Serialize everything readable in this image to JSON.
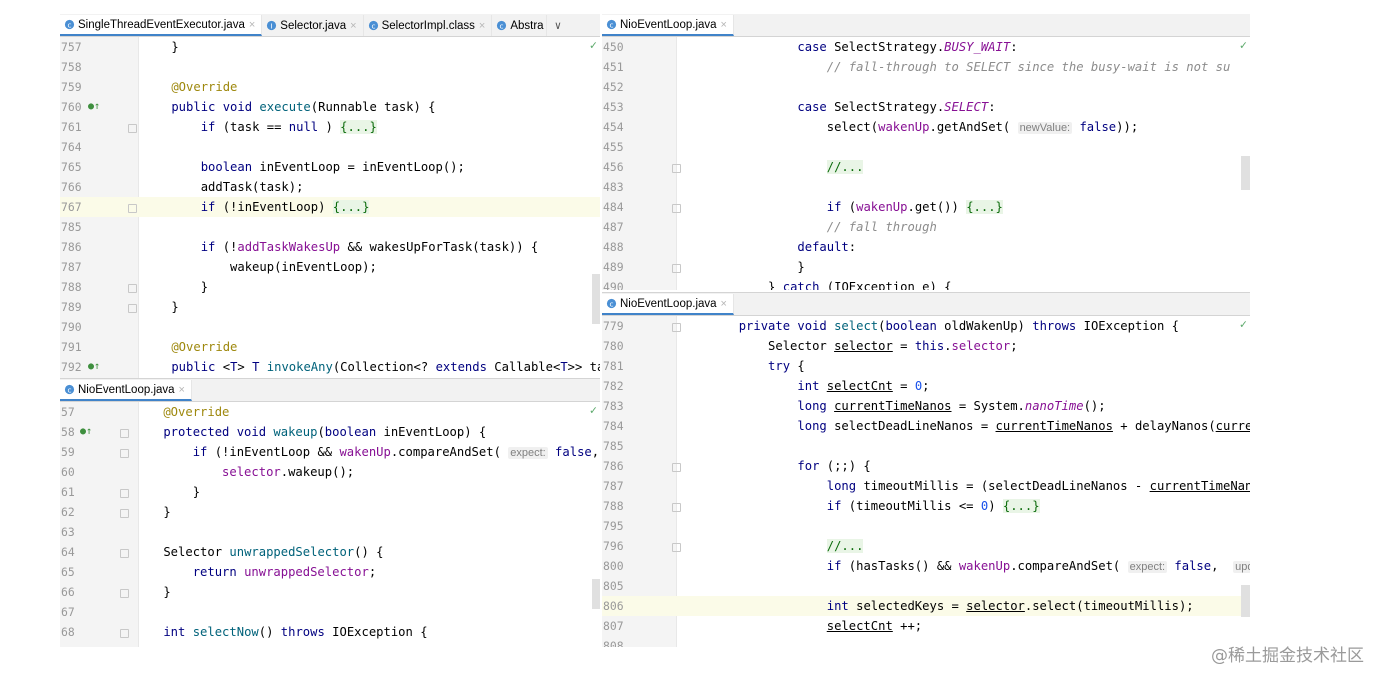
{
  "panes": {
    "top_left": {
      "tabs": [
        {
          "label": "SingleThreadEventExecutor.java",
          "active": true,
          "icon_color": "#4a8fd4"
        },
        {
          "label": "Selector.java",
          "active": false,
          "icon_color": "#4a8fd4"
        },
        {
          "label": "SelectorImpl.class",
          "active": false,
          "icon_color": "#4a8fd4"
        },
        {
          "label": "Abstra",
          "active": false,
          "icon_color": "#4a8fd4"
        }
      ],
      "overflow": "∨"
    },
    "bottom_left": {
      "tabs": [
        {
          "label": "NioEventLoop.java",
          "active": true,
          "icon_color": "#4a8fd4"
        }
      ]
    },
    "top_right": {
      "tabs": [
        {
          "label": "NioEventLoop.java",
          "active": true,
          "icon_color": "#4a8fd4"
        }
      ]
    },
    "bottom_right": {
      "tabs": [
        {
          "label": "NioEventLoop.java",
          "active": true,
          "icon_color": "#4a8fd4"
        }
      ]
    }
  },
  "code": {
    "top_left": [
      {
        "n": "757",
        "parts": [
          [
            "",
            "    }"
          ]
        ]
      },
      {
        "n": "758",
        "parts": []
      },
      {
        "n": "759",
        "parts": [
          [
            "an",
            "    @Override"
          ]
        ]
      },
      {
        "n": "760",
        "mark": "●↑",
        "parts": [
          [
            "kw",
            "    public void "
          ],
          [
            "fn",
            "execute"
          ],
          [
            "",
            "(Runnable task) {"
          ]
        ]
      },
      {
        "n": "761",
        "parts": [
          [
            "kw",
            "        if "
          ],
          [
            "",
            "(task == "
          ],
          [
            "kw",
            "null"
          ],
          [
            "",
            " ) "
          ],
          [
            "fb",
            "{...}"
          ]
        ]
      },
      {
        "n": "764",
        "parts": []
      },
      {
        "n": "765",
        "parts": [
          [
            "kw",
            "        boolean "
          ],
          [
            "",
            "inEventLoop = inEventLoop();"
          ]
        ]
      },
      {
        "n": "766",
        "parts": [
          [
            "",
            "        addTask(task);"
          ]
        ]
      },
      {
        "n": "767",
        "hl": true,
        "parts": [
          [
            "kw",
            "        if "
          ],
          [
            "",
            "(!inEventLoop) "
          ],
          [
            "fb",
            "{...}"
          ]
        ]
      },
      {
        "n": "785",
        "parts": []
      },
      {
        "n": "786",
        "parts": [
          [
            "kw",
            "        if "
          ],
          [
            "",
            "(!"
          ],
          [
            "fd",
            "addTaskWakesUp"
          ],
          [
            "",
            " && wakesUpForTask(task)) {"
          ]
        ]
      },
      {
        "n": "787",
        "parts": [
          [
            "",
            "            wakeup(inEventLoop);"
          ]
        ]
      },
      {
        "n": "788",
        "parts": [
          [
            "",
            "        }"
          ]
        ]
      },
      {
        "n": "789",
        "parts": [
          [
            "",
            "    }"
          ]
        ]
      },
      {
        "n": "790",
        "parts": []
      },
      {
        "n": "791",
        "parts": [
          [
            "an",
            "    @Override"
          ]
        ]
      },
      {
        "n": "792",
        "mark": "●↑",
        "parts": [
          [
            "kw",
            "    public "
          ],
          [
            "",
            "<"
          ],
          [
            "kw",
            "T"
          ],
          [
            "",
            "> "
          ],
          [
            "kw",
            "T "
          ],
          [
            "fn",
            "invokeAny"
          ],
          [
            "",
            "(Collection<? "
          ],
          [
            "kw",
            "extends "
          ],
          [
            "",
            "Callable<"
          ],
          [
            "kw",
            "T"
          ],
          [
            "",
            ">> tas"
          ]
        ]
      }
    ],
    "bottom_left": [
      {
        "n": "57",
        "parts": [
          [
            "an",
            "    @Override"
          ]
        ]
      },
      {
        "n": "58",
        "mark": "●↑",
        "parts": [
          [
            "kw",
            "    protected void "
          ],
          [
            "fn",
            "wakeup"
          ],
          [
            "",
            "("
          ],
          [
            "kw",
            "boolean "
          ],
          [
            "",
            "inEventLoop) {"
          ]
        ]
      },
      {
        "n": "59",
        "parts": [
          [
            "kw",
            "        if "
          ],
          [
            "",
            "(!inEventLoop && "
          ],
          [
            "fd",
            "wakenUp"
          ],
          [
            "",
            ".compareAndSet( "
          ],
          [
            "hint",
            "expect:"
          ],
          [
            "kw",
            " false"
          ],
          [
            "",
            ", "
          ]
        ]
      },
      {
        "n": "60",
        "parts": [
          [
            "fd",
            "            selector"
          ],
          [
            "",
            ".wakeup();"
          ]
        ]
      },
      {
        "n": "61",
        "parts": [
          [
            "",
            "        }"
          ]
        ]
      },
      {
        "n": "62",
        "parts": [
          [
            "",
            "    }"
          ]
        ]
      },
      {
        "n": "63",
        "parts": []
      },
      {
        "n": "64",
        "parts": [
          [
            "",
            "    Selector "
          ],
          [
            "fn",
            "unwrappedSelector"
          ],
          [
            "",
            "() {"
          ]
        ]
      },
      {
        "n": "65",
        "parts": [
          [
            "kw",
            "        return "
          ],
          [
            "fd",
            "unwrappedSelector"
          ],
          [
            "",
            ";"
          ]
        ]
      },
      {
        "n": "66",
        "parts": [
          [
            "",
            "    }"
          ]
        ]
      },
      {
        "n": "67",
        "parts": []
      },
      {
        "n": "68",
        "parts": [
          [
            "kw",
            "    int "
          ],
          [
            "fn",
            "selectNow"
          ],
          [
            "",
            "() "
          ],
          [
            "kw",
            "throws "
          ],
          [
            "",
            "IOException {"
          ]
        ]
      }
    ],
    "top_right": [
      {
        "n": "450",
        "parts": [
          [
            "kw",
            "                case "
          ],
          [
            "",
            "SelectStrategy."
          ],
          [
            "st",
            "BUSY_WAIT"
          ],
          [
            "",
            ":"
          ]
        ]
      },
      {
        "n": "451",
        "parts": [
          [
            "cm",
            "                    // fall-through to SELECT since the busy-wait is not su"
          ]
        ]
      },
      {
        "n": "452",
        "parts": []
      },
      {
        "n": "453",
        "parts": [
          [
            "kw",
            "                case "
          ],
          [
            "",
            "SelectStrategy."
          ],
          [
            "st",
            "SELECT"
          ],
          [
            "",
            ":"
          ]
        ]
      },
      {
        "n": "454",
        "parts": [
          [
            "",
            "                    select("
          ],
          [
            "fd",
            "wakenUp"
          ],
          [
            "",
            ".getAndSet( "
          ],
          [
            "hint",
            "newValue:"
          ],
          [
            "kw",
            " false"
          ],
          [
            "",
            "));"
          ]
        ]
      },
      {
        "n": "455",
        "parts": []
      },
      {
        "n": "456",
        "parts": [
          [
            "",
            "                    "
          ],
          [
            "fb",
            "//..."
          ]
        ]
      },
      {
        "n": "483",
        "parts": []
      },
      {
        "n": "484",
        "parts": [
          [
            "kw",
            "                    if "
          ],
          [
            "",
            "("
          ],
          [
            "fd",
            "wakenUp"
          ],
          [
            "",
            ".get()) "
          ],
          [
            "fb",
            "{...}"
          ]
        ]
      },
      {
        "n": "487",
        "parts": [
          [
            "cm",
            "                    // fall through"
          ]
        ]
      },
      {
        "n": "488",
        "parts": [
          [
            "kw",
            "                default"
          ],
          [
            "",
            ":"
          ]
        ]
      },
      {
        "n": "489",
        "parts": [
          [
            "",
            "                }"
          ]
        ]
      },
      {
        "n": "490",
        "parts": [
          [
            "",
            "            } "
          ],
          [
            "kw",
            "catch "
          ],
          [
            "",
            "(IOException e) {"
          ]
        ]
      }
    ],
    "bottom_right": [
      {
        "n": "779",
        "parts": [
          [
            "kw",
            "        private void "
          ],
          [
            "fn",
            "select"
          ],
          [
            "",
            "("
          ],
          [
            "kw",
            "boolean "
          ],
          [
            "",
            "oldWakenUp) "
          ],
          [
            "kw",
            "throws "
          ],
          [
            "",
            "IOException {"
          ]
        ]
      },
      {
        "n": "780",
        "parts": [
          [
            "",
            "            Selector "
          ],
          [
            "ul",
            "selector"
          ],
          [
            "",
            " = "
          ],
          [
            "kw",
            "this"
          ],
          [
            "",
            "."
          ],
          [
            "fd",
            "selector"
          ],
          [
            "",
            ";"
          ]
        ]
      },
      {
        "n": "781",
        "parts": [
          [
            "kw",
            "            try "
          ],
          [
            "",
            "{"
          ]
        ]
      },
      {
        "n": "782",
        "parts": [
          [
            "kw",
            "                int "
          ],
          [
            "ul",
            "selectCnt"
          ],
          [
            "",
            " = "
          ],
          [
            "num",
            "0"
          ],
          [
            "",
            ";"
          ]
        ]
      },
      {
        "n": "783",
        "parts": [
          [
            "kw",
            "                long "
          ],
          [
            "ul",
            "currentTimeNanos"
          ],
          [
            "",
            " = System."
          ],
          [
            "st",
            "nanoTime"
          ],
          [
            "",
            "();"
          ]
        ]
      },
      {
        "n": "784",
        "parts": [
          [
            "kw",
            "                long "
          ],
          [
            "",
            "selectDeadLineNanos = "
          ],
          [
            "ul",
            "currentTimeNanos"
          ],
          [
            "",
            " + delayNanos("
          ],
          [
            "ul",
            "currentTim"
          ]
        ]
      },
      {
        "n": "785",
        "parts": []
      },
      {
        "n": "786",
        "parts": [
          [
            "kw",
            "                for "
          ],
          [
            "",
            "(;;) {"
          ]
        ]
      },
      {
        "n": "787",
        "parts": [
          [
            "kw",
            "                    long "
          ],
          [
            "",
            "timeoutMillis = (selectDeadLineNanos - "
          ],
          [
            "ul",
            "currentTimeNanos"
          ],
          [
            "",
            " +"
          ]
        ]
      },
      {
        "n": "788",
        "parts": [
          [
            "kw",
            "                    if "
          ],
          [
            "",
            "(timeoutMillis <= "
          ],
          [
            "num",
            "0"
          ],
          [
            "",
            ") "
          ],
          [
            "fb",
            "{...}"
          ]
        ]
      },
      {
        "n": "795",
        "parts": []
      },
      {
        "n": "796",
        "parts": [
          [
            "",
            "                    "
          ],
          [
            "fb",
            "//..."
          ]
        ]
      },
      {
        "n": "800",
        "parts": [
          [
            "kw",
            "                    if "
          ],
          [
            "",
            "(hasTasks() && "
          ],
          [
            "fd",
            "wakenUp"
          ],
          [
            "",
            ".compareAndSet( "
          ],
          [
            "hint",
            "expect:"
          ],
          [
            "kw",
            " false"
          ],
          [
            "",
            ",  "
          ],
          [
            "hint",
            "update:"
          ],
          [
            "",
            " t"
          ]
        ]
      },
      {
        "n": "805",
        "parts": []
      },
      {
        "n": "806",
        "hl": true,
        "parts": [
          [
            "kw",
            "                    int "
          ],
          [
            "",
            "selectedKeys = "
          ],
          [
            "ul",
            "selector"
          ],
          [
            "",
            ".select(timeoutMillis);"
          ]
        ]
      },
      {
        "n": "807",
        "parts": [
          [
            "",
            "                    "
          ],
          [
            "ul",
            "selectCnt"
          ],
          [
            "",
            " ++;"
          ]
        ]
      },
      {
        "n": "808",
        "parts": []
      }
    ]
  },
  "watermark": "@稀土掘金技术社区"
}
